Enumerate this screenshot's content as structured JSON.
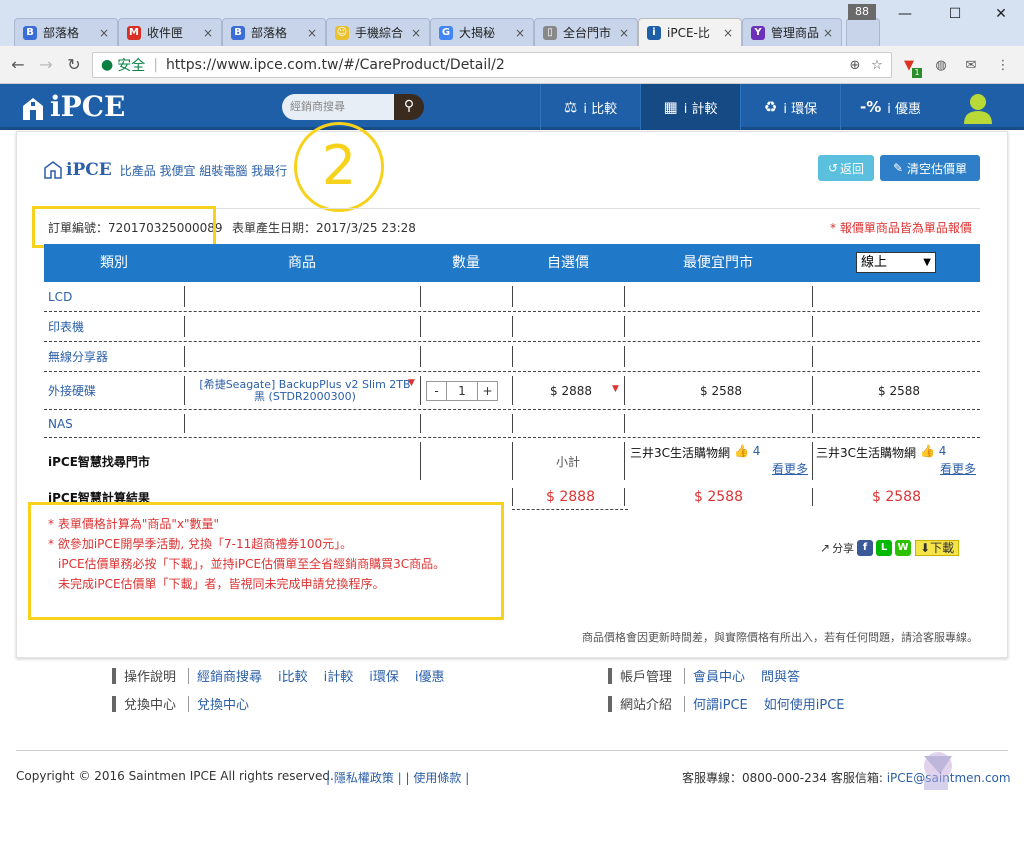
{
  "browser": {
    "tabs": [
      {
        "label": "部落格",
        "color": "#3b6dd6",
        "glyph": "B"
      },
      {
        "label": "收件匣",
        "color": "#d93025",
        "glyph": "M"
      },
      {
        "label": "部落格",
        "color": "#3b6dd6",
        "glyph": "B"
      },
      {
        "label": "手機綜合",
        "color": "#e8c230",
        "glyph": "☺"
      },
      {
        "label": "大揭秘",
        "color": "#4285f4",
        "glyph": "G"
      },
      {
        "label": "全台門市",
        "color": "#888888",
        "glyph": "▯"
      },
      {
        "label": "iPCE-比",
        "color": "#1e5fa8",
        "glyph": "i"
      },
      {
        "label": "管理商品",
        "color": "#6b2fb8",
        "glyph": "Y"
      }
    ],
    "tab_close": "×",
    "tab_count": "88",
    "win_min": "—",
    "win_max": "☐",
    "win_close": "✕",
    "nav_back": "←",
    "nav_forward": "→",
    "nav_reload": "↻",
    "lock_glyph": "🔒",
    "secure_label": "安全",
    "url": "https://www.ipce.com.tw/#/CareProduct/Detail/2",
    "zoom_glyph": "⊕",
    "star_glyph": "☆",
    "menu_glyph": "⋮",
    "ext_badge": "1"
  },
  "site": {
    "logo_text": "iPCE",
    "search_placeholder": "經銷商搜尋",
    "search_glyph": "🔍",
    "nav": [
      {
        "icon": "⚖",
        "label": "i 比較",
        "active": false
      },
      {
        "icon": "▦",
        "label": "i 計較",
        "active": true
      },
      {
        "icon": "♻",
        "label": "i 環保",
        "active": false
      },
      {
        "icon": "-%",
        "label": "i 優惠",
        "active": false
      }
    ]
  },
  "card": {
    "brand_name": "iPCE",
    "slogan": "比產品 我便宜 組裝電腦 我最行",
    "back_label": "返回",
    "back_glyph": "↺",
    "clear_label": "清空估價單",
    "clear_glyph": "🧹",
    "order_no": "訂單編號：720170325000089",
    "order_date": "表單產生日期：2017/3/25 23:28",
    "note": "* 報價單商品皆為單品報價",
    "step_number": "2"
  },
  "table": {
    "headers": [
      "類別",
      "商品",
      "數量",
      "自選價",
      "最便宜門市"
    ],
    "select_value": "線上",
    "select_arrow": "▼",
    "rows": [
      {
        "cat": "LCD"
      },
      {
        "cat": "印表機"
      },
      {
        "cat": "無線分享器"
      },
      {
        "cat": "外接硬碟",
        "product_line1": "[希捷Seagate] BackupPlus v2 Slim 2TB",
        "product_line2": "黑 (STDR2000300)",
        "minus": "-",
        "qty": "1",
        "plus": "+",
        "price": "$ 2888",
        "cheapest": "$ 2588",
        "online": "$ 2588"
      },
      {
        "cat": "NAS"
      }
    ],
    "finder_label": "iPCE智慧找尋門市",
    "subtotal_label": "小計",
    "store1": "三井3C生活購物網",
    "store1_likes": "4",
    "store2": "三井3C生活購物網",
    "store2_likes": "4",
    "more_label": "看更多",
    "calc_label": "iPCE智慧計算結果",
    "total_self": "$ 2888",
    "total_cheapest": "$ 2588",
    "total_online": "$ 2588"
  },
  "notes": {
    "line1": "* 表單價格計算為\"商品\"x\"數量\"",
    "line2": "* 欲參加iPCE開學季活動, 兌換「7-11超商禮券100元」。",
    "line3": "iPCE估價單務必按「下載」，並持iPCE估價單至全省經銷商購買3C商品。",
    "line4": "未完成iPCE估價單「下載」者，皆視同未完成申請兌換程序。"
  },
  "share": {
    "label": "分享",
    "download": "下載",
    "fb": "f",
    "line": "L",
    "wechat": "W"
  },
  "disclaimer": "商品價格會因更新時間差，與實際價格有所出入，若有任何問題，請洽客服專線。",
  "footer": {
    "col1_title": "操作說明",
    "col1_links": [
      "經銷商搜尋",
      "i比較",
      "i計較",
      "i環保",
      "i優惠"
    ],
    "col1b_title": "兌換中心",
    "col1b_links": [
      "兌換中心"
    ],
    "col2_title": "帳戶管理",
    "col2_links": [
      "會員中心",
      "問與答"
    ],
    "col2b_title": "網站介紹",
    "col2b_links": [
      "何謂iPCE",
      "如何使用iPCE"
    ],
    "copyright": "Copyright © 2016 Saintmen IPCE All rights reserved.",
    "policy_links": "| 隱私權政策 | | 使用條款 |",
    "hotline_label": "客服專線：0800-000-234  客服信箱: ",
    "email": "iPCE@saintmen.com"
  },
  "colors": {
    "brand_blue": "#1e5fa8",
    "table_head": "#1f78c8",
    "price_red": "#dd3333",
    "highlight": "#f7d21c"
  }
}
